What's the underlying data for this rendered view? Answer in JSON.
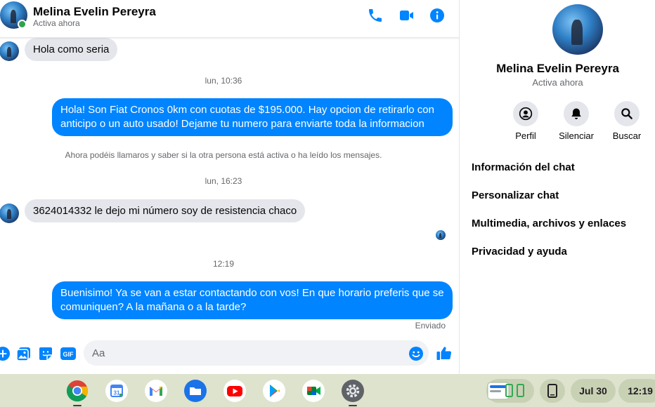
{
  "contact": {
    "name": "Melina Evelin Pereyra",
    "status": "Activa ahora"
  },
  "header": {
    "icons": [
      "phone-icon",
      "video-camera-icon",
      "info-icon"
    ]
  },
  "messages": [
    {
      "type": "incoming",
      "text": "Hola como seria"
    },
    {
      "type": "time",
      "text": "lun, 10:36"
    },
    {
      "type": "outgoing",
      "text": "Hola! Son Fiat Cronos 0km con cuotas de $195.000. Hay opcion de retirarlo con anticipo o un auto usado! Dejame tu numero para enviarte toda la informacion"
    },
    {
      "type": "notice",
      "text": "Ahora podéis llamaros y saber si la otra persona está activa o ha leído los mensajes."
    },
    {
      "type": "time",
      "text": "lun, 16:23"
    },
    {
      "type": "incoming",
      "text": "3624014332 le dejo mi número soy de resistencia chaco"
    },
    {
      "type": "time",
      "text": "12:19"
    },
    {
      "type": "outgoing",
      "text": "Buenisimo! Ya se van a estar contactando con vos! En que horario preferis que se comuniquen? A la mañana o a la tarde?"
    },
    {
      "type": "status",
      "text": "Enviado"
    }
  ],
  "composer": {
    "placeholder": "Aa",
    "icons": [
      "plus-icon",
      "image-icon",
      "sticker-icon",
      "gif-icon",
      "emoji-icon",
      "thumbs-up-icon"
    ],
    "gif_label": "GIF"
  },
  "info_panel": {
    "actions": [
      {
        "label": "Perfil",
        "icon": "profile-icon"
      },
      {
        "label": "Silenciar",
        "icon": "bell-icon"
      },
      {
        "label": "Buscar",
        "icon": "search-icon"
      }
    ],
    "menu": [
      "Información del chat",
      "Personalizar chat",
      "Multimedia, archivos y enlaces",
      "Privacidad y ayuda"
    ]
  },
  "shelf": {
    "apps": [
      "chrome-icon",
      "calendar-icon",
      "gmail-icon",
      "files-icon",
      "youtube-icon",
      "play-store-icon",
      "meet-icon",
      "settings-icon"
    ],
    "calendar_day": "31",
    "date": "Jul 30",
    "time": "12:19"
  },
  "colors": {
    "accent": "#0084ff",
    "incoming_bubble": "#e4e6eb",
    "online": "#31a24c",
    "shelf": "#dde3cd"
  }
}
